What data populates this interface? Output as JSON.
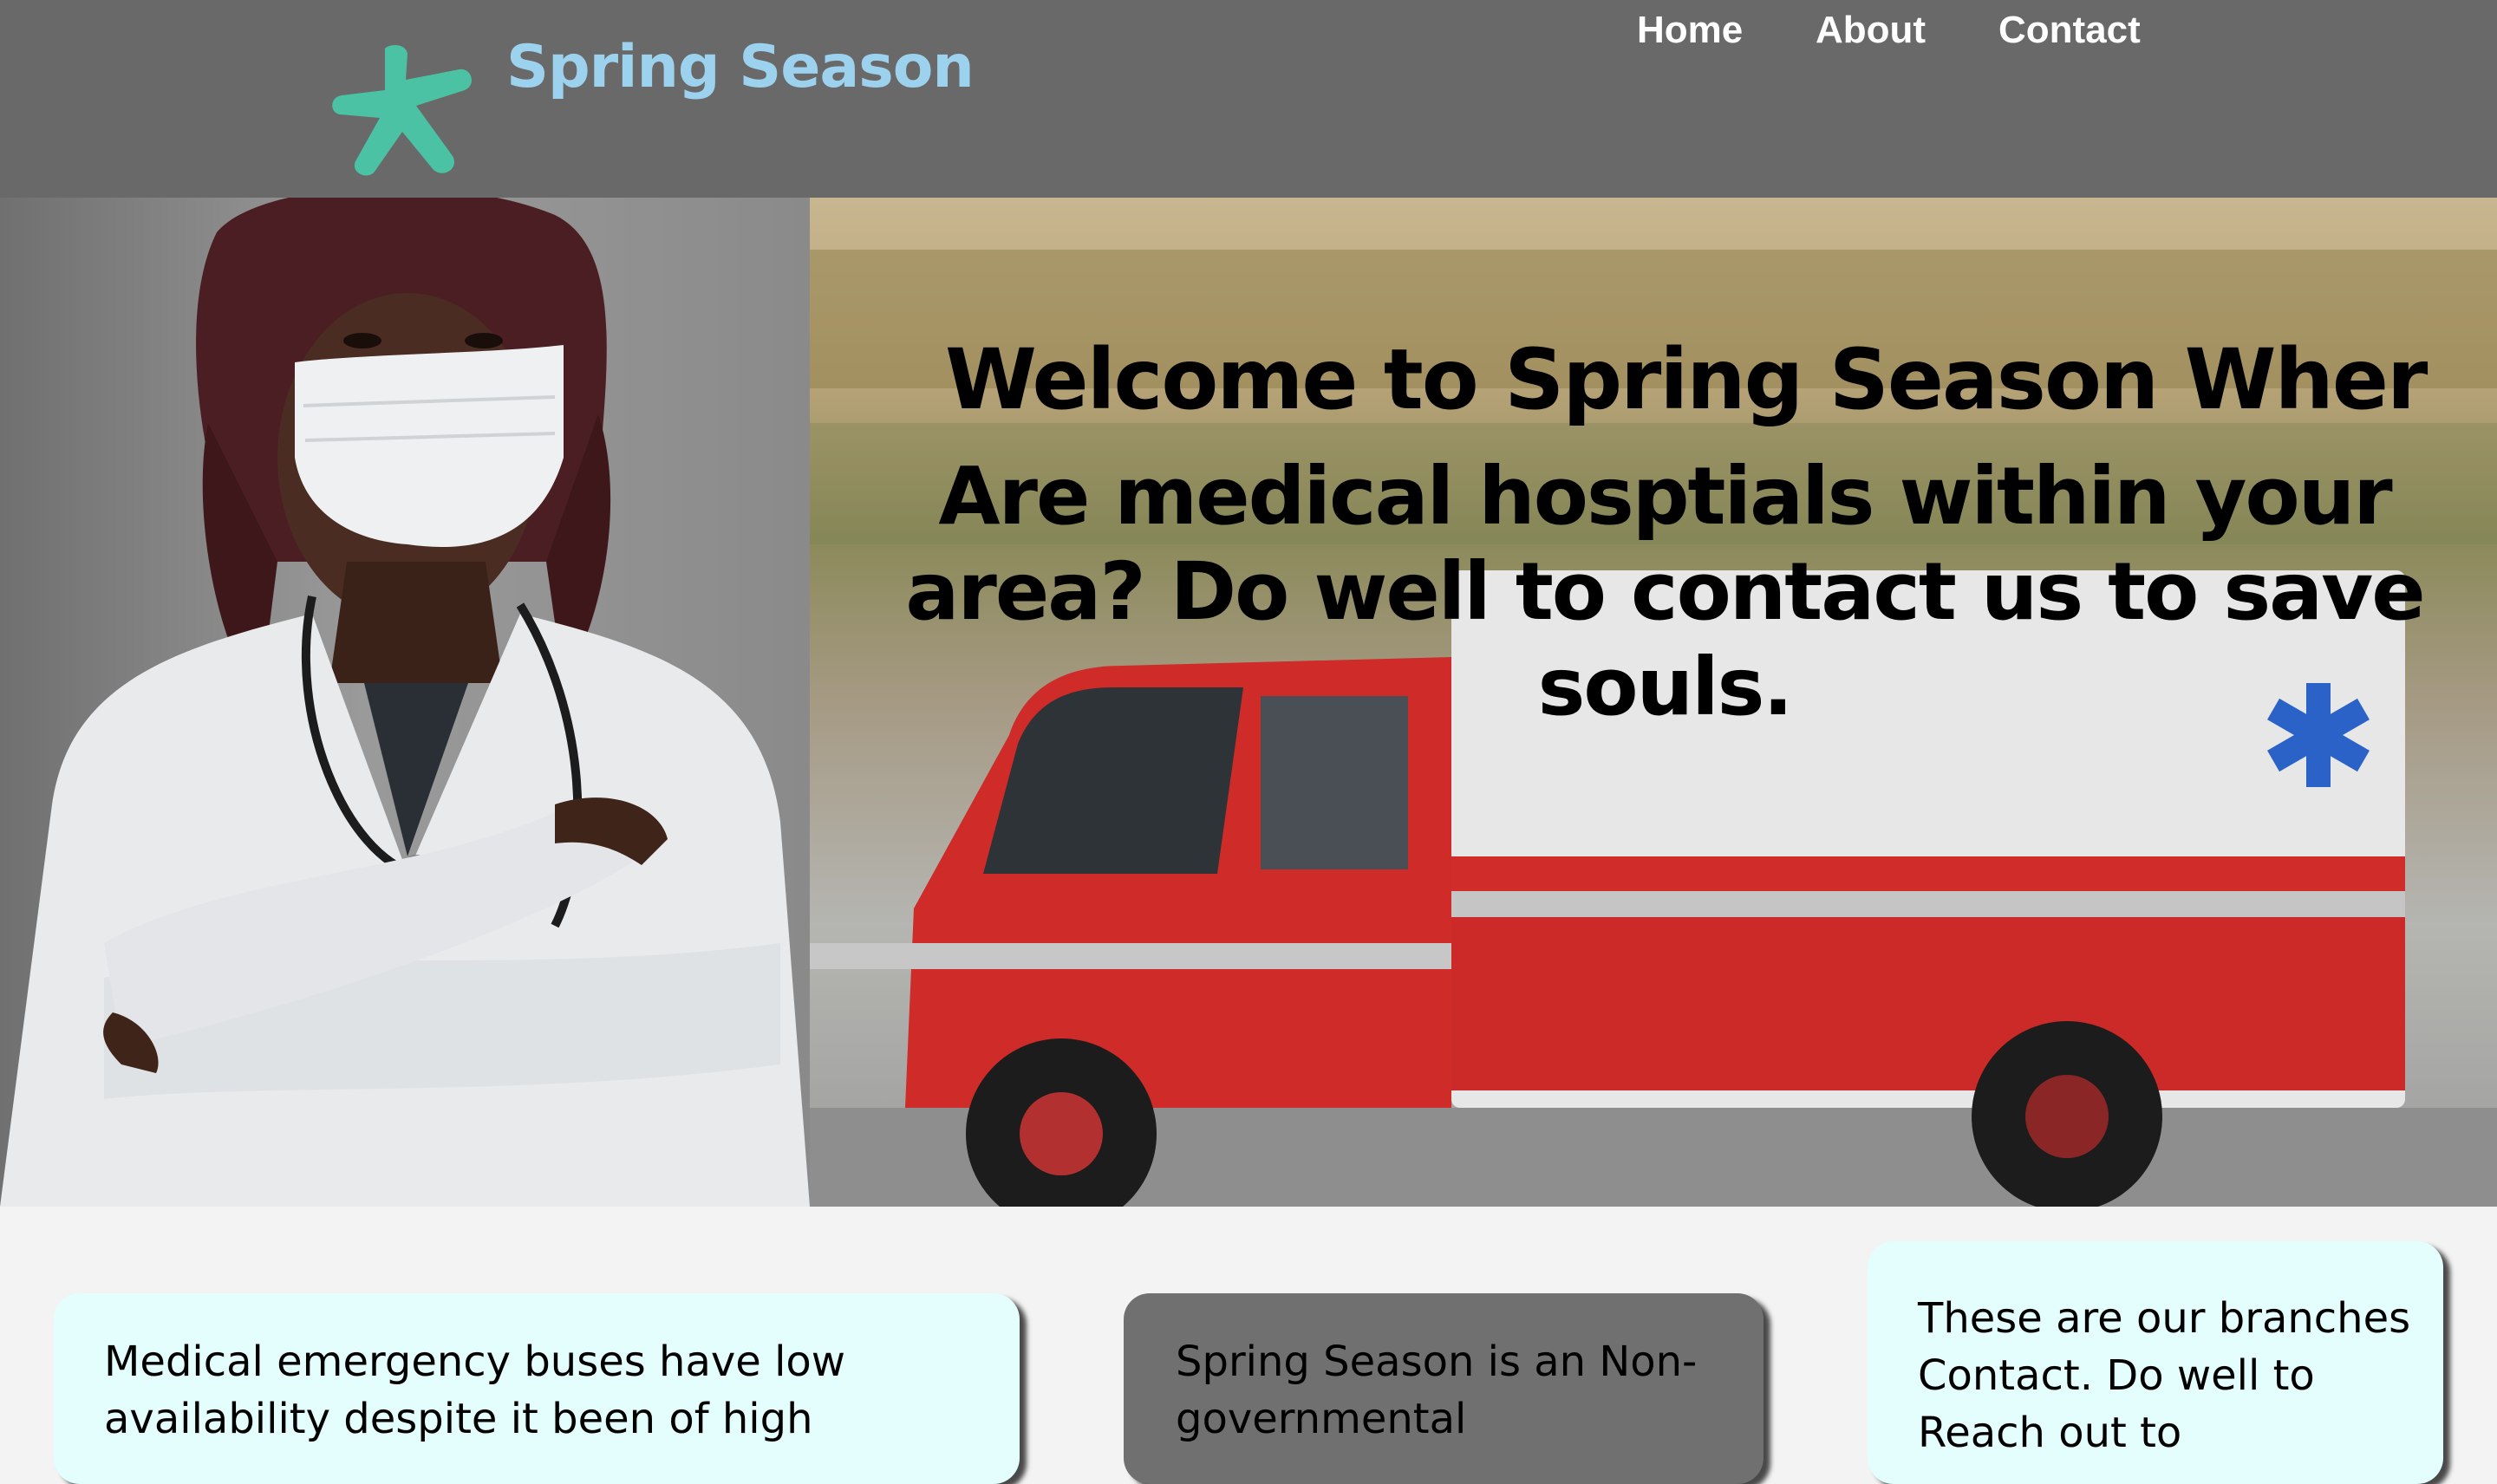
{
  "header": {
    "brand": "Spring Season",
    "nav": {
      "home": "Home",
      "about": "About",
      "contact": "Contact"
    },
    "colors": {
      "bar": "#696969",
      "brand": "#9cd2ee",
      "logo": "#4cc2a4"
    }
  },
  "hero": {
    "title": "Welcome to Spring Season Wher",
    "paragraph": "Are medical hosptials within your area? Do well to contact us to save souls."
  },
  "cards": [
    {
      "text": "Medical emergency buses have low availability despite it been of high",
      "bg": "#e4fdfd"
    },
    {
      "text": "Spring Season is an Non-governmental",
      "bg": "#707070"
    },
    {
      "text": "These are our branches Contact. Do well to Reach out to",
      "bg": "#e4fdfd"
    }
  ]
}
